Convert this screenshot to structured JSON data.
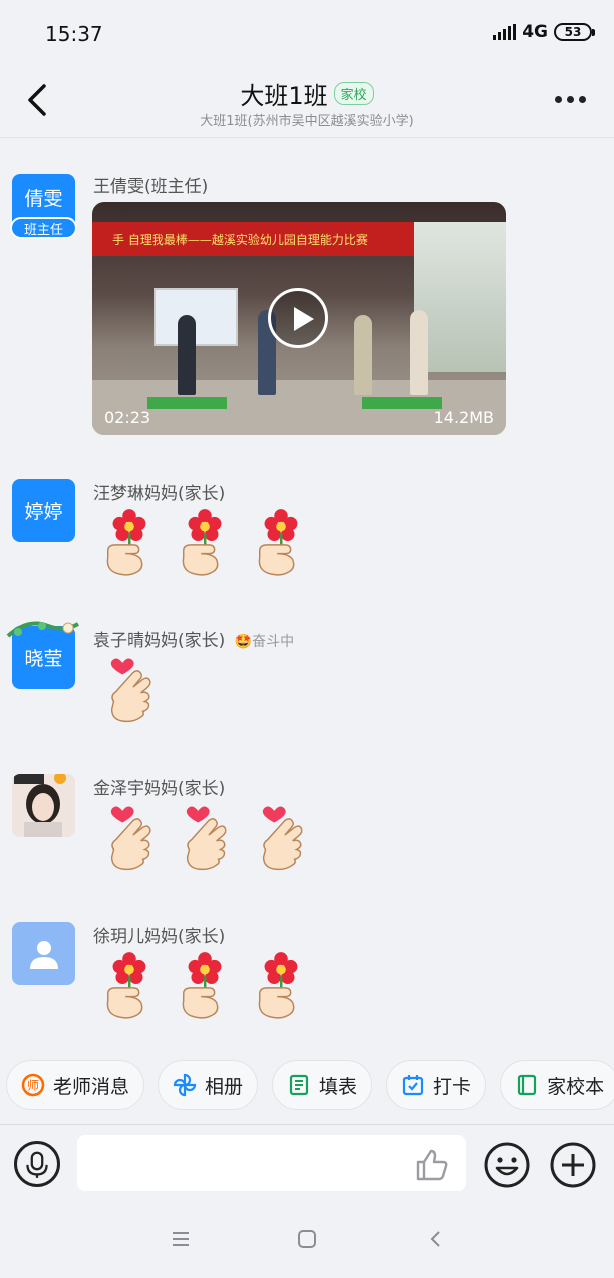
{
  "status_bar": {
    "time": "15:37",
    "network": "4G",
    "battery": "53"
  },
  "header": {
    "title": "大班1班",
    "tag": "家校",
    "subtitle": "大班1班(苏州市吴中区越溪实验小学)"
  },
  "messages": [
    {
      "sender": "王倩雯(班主任)",
      "avatar_text": "倩雯",
      "avatar_role": "班主任",
      "type": "video",
      "video": {
        "banner": "手 自理我最棒——越溪实验幼儿园自理能力比赛",
        "duration": "02:23",
        "size": "14.2MB"
      }
    },
    {
      "sender": "汪梦琳妈妈(家长)",
      "avatar_text": "婷婷",
      "type": "emoji",
      "emojis": [
        "flower-hand-icon",
        "flower-hand-icon",
        "flower-hand-icon"
      ]
    },
    {
      "sender": "袁子晴妈妈(家长)",
      "sender_status": "奋斗中",
      "avatar_text": "晓莹",
      "type": "emoji",
      "emojis": [
        "finger-heart-icon"
      ]
    },
    {
      "sender": "金泽宇妈妈(家长)",
      "avatar_text": "",
      "type": "emoji",
      "emojis": [
        "finger-heart-icon",
        "finger-heart-icon",
        "finger-heart-icon"
      ]
    },
    {
      "sender": "徐玥儿妈妈(家长)",
      "avatar_text": "",
      "type": "emoji",
      "emojis": [
        "flower-hand-icon",
        "flower-hand-icon",
        "flower-hand-icon"
      ]
    }
  ],
  "quickbar": [
    {
      "label": "老师消息",
      "icon": "teacher-icon",
      "color": "#ff6a00"
    },
    {
      "label": "相册",
      "icon": "pinwheel-icon",
      "color": "#1a8cff"
    },
    {
      "label": "填表",
      "icon": "form-icon",
      "color": "#17a05d"
    },
    {
      "label": "打卡",
      "icon": "calendar-check-icon",
      "color": "#1a8cff"
    },
    {
      "label": "家校本",
      "icon": "notebook-icon",
      "color": "#17a05d"
    }
  ],
  "input": {
    "placeholder": ""
  },
  "colors": {
    "accent": "#1a8cff",
    "tag_green": "#2aa55a",
    "background": "#f1f2f5"
  }
}
